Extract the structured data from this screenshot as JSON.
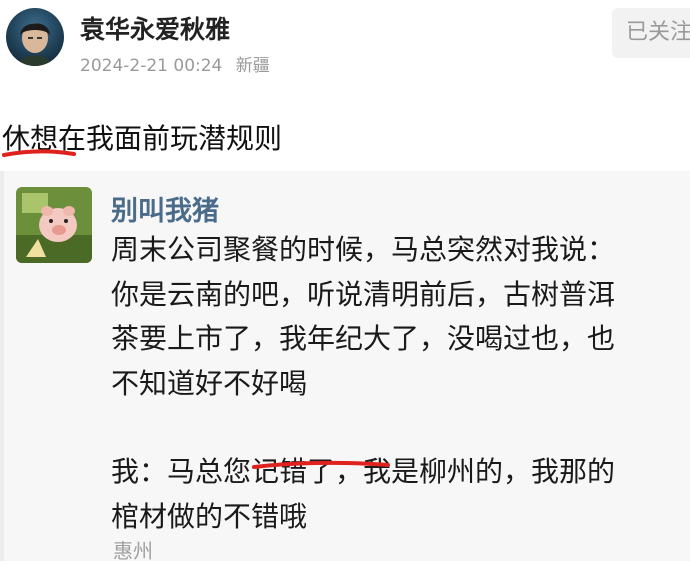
{
  "post": {
    "username": "袁华永爱秋雅",
    "timestamp": "2024-2-21 00:24",
    "location": "新疆",
    "follow_label": "已关注",
    "text": "休想在我面前玩潜规则"
  },
  "quoted": {
    "username": "别叫我猪",
    "lines": [
      "周末公司聚餐的时候，马总突然对我说：",
      "你是云南的吧，听说清明前后，古树普洱",
      "茶要上市了，我年纪大了，没喝过也，也",
      "不知道好不好喝"
    ],
    "reply_lines": [
      "我：马总您记错了，我是柳州的，我那的",
      "棺材做的不错哦"
    ],
    "location": "惠州"
  },
  "colors": {
    "annotation_red": "#e0221f",
    "quote_bg": "#f7f7f7",
    "quote_name": "#4a6b8a",
    "meta_gray": "#9a9a9a"
  },
  "icons": {
    "user_avatar": "avatar-portrait-icon",
    "quoted_avatar": "pig-avatar-icon"
  }
}
